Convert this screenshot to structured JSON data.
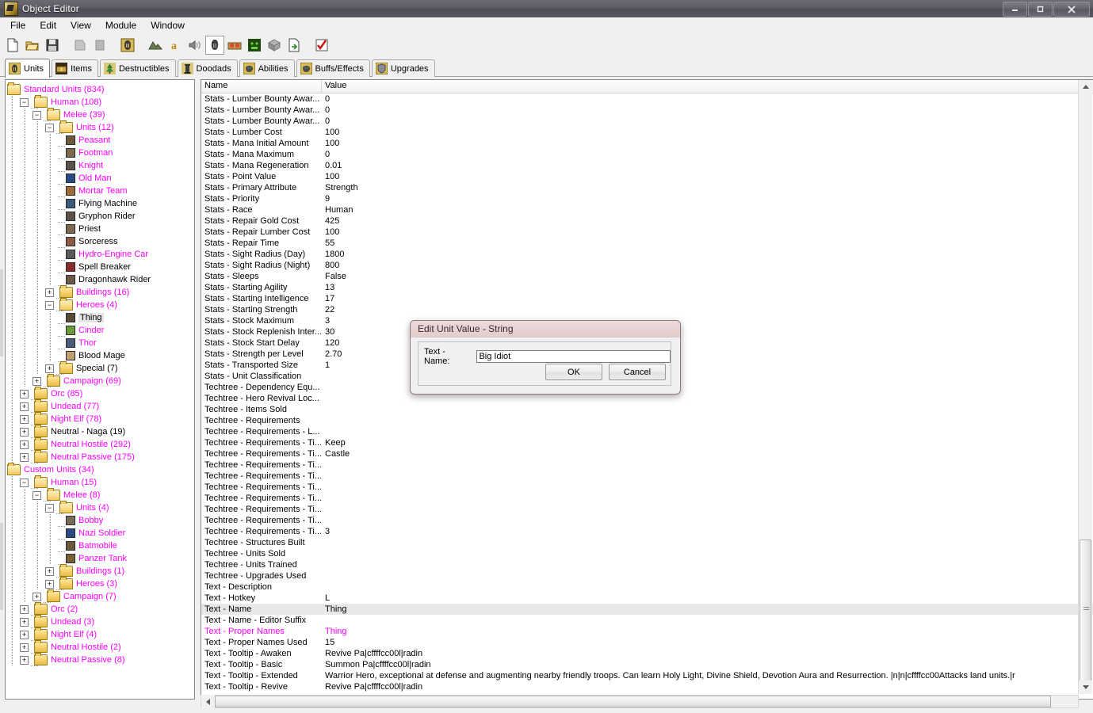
{
  "window": {
    "title": "Object Editor",
    "icon": "warcraft-object-editor-icon",
    "minimize": "–",
    "maximize": "❐",
    "close": "✕"
  },
  "menubar": {
    "items": [
      "File",
      "Edit",
      "View",
      "Module",
      "Window"
    ]
  },
  "toolbar": {
    "buttons": [
      {
        "name": "new-file-button",
        "icon": "new-document-icon",
        "enabled": true,
        "pressed": false
      },
      {
        "name": "open-file-button",
        "icon": "open-folder-icon",
        "enabled": true,
        "pressed": false
      },
      {
        "name": "save-file-button",
        "icon": "floppy-save-icon",
        "enabled": true,
        "pressed": false
      },
      {
        "name": "copy-button",
        "icon": "copy-icon",
        "enabled": false,
        "pressed": false
      },
      {
        "name": "paste-button",
        "icon": "paste-icon",
        "enabled": false,
        "pressed": false
      },
      {
        "name": "object-editor-button",
        "icon": "helmet-icon",
        "enabled": true,
        "pressed": false
      },
      {
        "name": "terrain-editor-button",
        "icon": "terrain-icon",
        "enabled": true,
        "pressed": false
      },
      {
        "name": "trigger-editor-button",
        "icon": "letter-a-icon",
        "enabled": true,
        "pressed": false
      },
      {
        "name": "sound-editor-button",
        "icon": "speaker-icon",
        "enabled": true,
        "pressed": false
      },
      {
        "name": "unit-palette-button",
        "icon": "helmet-dark-icon",
        "enabled": true,
        "pressed": true
      },
      {
        "name": "import-manager-button",
        "icon": "chest-icon",
        "enabled": true,
        "pressed": false
      },
      {
        "name": "ai-editor-button",
        "icon": "orc-face-icon",
        "enabled": true,
        "pressed": false
      },
      {
        "name": "object-manager-button",
        "icon": "cube-icon",
        "enabled": true,
        "pressed": false
      },
      {
        "name": "export-button",
        "icon": "export-page-icon",
        "enabled": true,
        "pressed": false
      },
      {
        "name": "test-map-button",
        "icon": "checkmark-icon",
        "enabled": true,
        "pressed": false
      }
    ]
  },
  "tabs": {
    "items": [
      {
        "label": "Units",
        "icon": "helmet-icon",
        "active": true
      },
      {
        "label": "Items",
        "icon": "chest-icon",
        "active": false
      },
      {
        "label": "Destructibles",
        "icon": "tree-icon",
        "active": false
      },
      {
        "label": "Doodads",
        "icon": "tower-icon",
        "active": false
      },
      {
        "label": "Abilities",
        "icon": "fist-icon",
        "active": false
      },
      {
        "label": "Buffs/Effects",
        "icon": "fist-icon",
        "active": false
      },
      {
        "label": "Upgrades",
        "icon": "shield-icon",
        "active": false
      }
    ]
  },
  "tree": {
    "nodes": [
      {
        "label": "Standard Units (834)",
        "depth": 0,
        "type": "folder-open",
        "expander": "none",
        "modified": true
      },
      {
        "label": "Human (108)",
        "depth": 1,
        "type": "folder-open",
        "expander": "minus",
        "modified": true
      },
      {
        "label": "Melee (39)",
        "depth": 2,
        "type": "folder-open",
        "expander": "minus",
        "modified": true
      },
      {
        "label": "Units (12)",
        "depth": 3,
        "type": "folder-open",
        "expander": "minus",
        "modified": true
      },
      {
        "label": "Peasant",
        "depth": 4,
        "type": "unit",
        "expander": "none",
        "modified": true,
        "color": "#6b5a3e"
      },
      {
        "label": "Footman",
        "depth": 4,
        "type": "unit",
        "expander": "none",
        "modified": true,
        "color": "#7a6a4a"
      },
      {
        "label": "Knight",
        "depth": 4,
        "type": "unit",
        "expander": "none",
        "modified": true,
        "color": "#59514a"
      },
      {
        "label": "Old Man",
        "depth": 4,
        "type": "unit",
        "expander": "none",
        "modified": true,
        "color": "#2a4a86"
      },
      {
        "label": "Mortar Team",
        "depth": 4,
        "type": "unit",
        "expander": "none",
        "modified": true,
        "color": "#a06a38"
      },
      {
        "label": "Flying Machine",
        "depth": 4,
        "type": "unit",
        "expander": "none",
        "modified": false,
        "color": "#3a5a7a"
      },
      {
        "label": "Gryphon Rider",
        "depth": 4,
        "type": "unit",
        "expander": "none",
        "modified": false,
        "color": "#5a5248"
      },
      {
        "label": "Priest",
        "depth": 4,
        "type": "unit",
        "expander": "none",
        "modified": false,
        "color": "#7a6850"
      },
      {
        "label": "Sorceress",
        "depth": 4,
        "type": "unit",
        "expander": "none",
        "modified": false,
        "color": "#8a5a42"
      },
      {
        "label": "Hydro-Engine Car",
        "depth": 4,
        "type": "unit",
        "expander": "none",
        "modified": true,
        "color": "#5a5a5a"
      },
      {
        "label": "Spell Breaker",
        "depth": 4,
        "type": "unit",
        "expander": "none",
        "modified": false,
        "color": "#8a2a2a"
      },
      {
        "label": "Dragonhawk Rider",
        "depth": 4,
        "type": "unit",
        "expander": "none",
        "modified": false,
        "color": "#6a5a4a"
      },
      {
        "label": "Buildings (16)",
        "depth": 3,
        "type": "folder",
        "expander": "plus",
        "modified": true
      },
      {
        "label": "Heroes (4)",
        "depth": 3,
        "type": "folder-open",
        "expander": "minus",
        "modified": true
      },
      {
        "label": "Thing",
        "depth": 4,
        "type": "unit",
        "expander": "none",
        "modified": false,
        "selected": true,
        "color": "#5a4a3a"
      },
      {
        "label": "Cinder",
        "depth": 4,
        "type": "unit",
        "expander": "none",
        "modified": true,
        "color": "#6a9a3a"
      },
      {
        "label": "Thor",
        "depth": 4,
        "type": "unit",
        "expander": "none",
        "modified": true,
        "color": "#4a5a7a"
      },
      {
        "label": "Blood Mage",
        "depth": 4,
        "type": "unit",
        "expander": "none",
        "modified": false,
        "color": "#c0a070"
      },
      {
        "label": "Special (7)",
        "depth": 3,
        "type": "folder",
        "expander": "plus",
        "modified": false
      },
      {
        "label": "Campaign (69)",
        "depth": 2,
        "type": "folder",
        "expander": "plus",
        "modified": true
      },
      {
        "label": "Orc (85)",
        "depth": 1,
        "type": "folder",
        "expander": "plus",
        "modified": true
      },
      {
        "label": "Undead (77)",
        "depth": 1,
        "type": "folder",
        "expander": "plus",
        "modified": true
      },
      {
        "label": "Night Elf (78)",
        "depth": 1,
        "type": "folder",
        "expander": "plus",
        "modified": true
      },
      {
        "label": "Neutral - Naga (19)",
        "depth": 1,
        "type": "folder",
        "expander": "plus",
        "modified": false
      },
      {
        "label": "Neutral Hostile (292)",
        "depth": 1,
        "type": "folder",
        "expander": "plus",
        "modified": true
      },
      {
        "label": "Neutral Passive (175)",
        "depth": 1,
        "type": "folder",
        "expander": "plus",
        "modified": true
      },
      {
        "label": "Custom Units (34)",
        "depth": 0,
        "type": "folder-open",
        "expander": "none",
        "modified": true
      },
      {
        "label": "Human (15)",
        "depth": 1,
        "type": "folder-open",
        "expander": "minus",
        "modified": true
      },
      {
        "label": "Melee (8)",
        "depth": 2,
        "type": "folder-open",
        "expander": "minus",
        "modified": true
      },
      {
        "label": "Units (4)",
        "depth": 3,
        "type": "folder-open",
        "expander": "minus",
        "modified": true
      },
      {
        "label": "Bobby",
        "depth": 4,
        "type": "unit",
        "expander": "none",
        "modified": true,
        "color": "#7a6a5a"
      },
      {
        "label": "Nazi Soldier",
        "depth": 4,
        "type": "unit",
        "expander": "none",
        "modified": true,
        "color": "#2a4a86"
      },
      {
        "label": "Batmobile",
        "depth": 4,
        "type": "unit",
        "expander": "none",
        "modified": true,
        "color": "#6a5a3a"
      },
      {
        "label": "Panzer Tank",
        "depth": 4,
        "type": "unit",
        "expander": "none",
        "modified": true,
        "color": "#7a6238"
      },
      {
        "label": "Buildings (1)",
        "depth": 3,
        "type": "folder",
        "expander": "plus",
        "modified": true
      },
      {
        "label": "Heroes (3)",
        "depth": 3,
        "type": "folder",
        "expander": "plus",
        "modified": true
      },
      {
        "label": "Campaign (7)",
        "depth": 2,
        "type": "folder",
        "expander": "plus",
        "modified": true
      },
      {
        "label": "Orc (2)",
        "depth": 1,
        "type": "folder",
        "expander": "plus",
        "modified": true
      },
      {
        "label": "Undead (3)",
        "depth": 1,
        "type": "folder",
        "expander": "plus",
        "modified": true
      },
      {
        "label": "Night Elf (4)",
        "depth": 1,
        "type": "folder",
        "expander": "plus",
        "modified": true
      },
      {
        "label": "Neutral Hostile (2)",
        "depth": 1,
        "type": "folder",
        "expander": "plus",
        "modified": true
      },
      {
        "label": "Neutral Passive (8)",
        "depth": 1,
        "type": "folder",
        "expander": "plus",
        "modified": true
      }
    ]
  },
  "proplist": {
    "columns": [
      "Name",
      "Value"
    ],
    "rows": [
      {
        "name": "Stats - Lumber Bounty Awar...",
        "value": "0",
        "modified": false
      },
      {
        "name": "Stats - Lumber Bounty Awar...",
        "value": "0",
        "modified": false
      },
      {
        "name": "Stats - Lumber Bounty Awar...",
        "value": "0",
        "modified": false
      },
      {
        "name": "Stats - Lumber Cost",
        "value": "100",
        "modified": false
      },
      {
        "name": "Stats - Mana Initial Amount",
        "value": "100",
        "modified": false
      },
      {
        "name": "Stats - Mana Maximum",
        "value": "0",
        "modified": false
      },
      {
        "name": "Stats - Mana Regeneration",
        "value": "0.01",
        "modified": false
      },
      {
        "name": "Stats - Point Value",
        "value": "100",
        "modified": false
      },
      {
        "name": "Stats - Primary Attribute",
        "value": "Strength",
        "modified": false
      },
      {
        "name": "Stats - Priority",
        "value": "9",
        "modified": false
      },
      {
        "name": "Stats - Race",
        "value": "Human",
        "modified": false
      },
      {
        "name": "Stats - Repair Gold Cost",
        "value": "425",
        "modified": false
      },
      {
        "name": "Stats - Repair Lumber Cost",
        "value": "100",
        "modified": false
      },
      {
        "name": "Stats - Repair Time",
        "value": "55",
        "modified": false
      },
      {
        "name": "Stats - Sight Radius (Day)",
        "value": "1800",
        "modified": false
      },
      {
        "name": "Stats - Sight Radius (Night)",
        "value": "800",
        "modified": false
      },
      {
        "name": "Stats - Sleeps",
        "value": "False",
        "modified": false
      },
      {
        "name": "Stats - Starting Agility",
        "value": "13",
        "modified": false
      },
      {
        "name": "Stats - Starting Intelligence",
        "value": "17",
        "modified": false
      },
      {
        "name": "Stats - Starting Strength",
        "value": "22",
        "modified": false
      },
      {
        "name": "Stats - Stock Maximum",
        "value": "3",
        "modified": false
      },
      {
        "name": "Stats - Stock Replenish Inter...",
        "value": "30",
        "modified": false
      },
      {
        "name": "Stats - Stock Start Delay",
        "value": "120",
        "modified": false
      },
      {
        "name": "Stats - Strength per Level",
        "value": "2.70",
        "modified": false
      },
      {
        "name": "Stats - Transported Size",
        "value": "1",
        "modified": false
      },
      {
        "name": "Stats - Unit Classification",
        "value": "",
        "modified": false
      },
      {
        "name": "Techtree - Dependency Equ...",
        "value": "",
        "modified": false
      },
      {
        "name": "Techtree - Hero Revival Loc...",
        "value": "",
        "modified": false
      },
      {
        "name": "Techtree - Items Sold",
        "value": "",
        "modified": false
      },
      {
        "name": "Techtree - Requirements",
        "value": "",
        "modified": false
      },
      {
        "name": "Techtree - Requirements - L...",
        "value": "",
        "modified": false
      },
      {
        "name": "Techtree - Requirements - Ti...",
        "value": "Keep",
        "modified": false
      },
      {
        "name": "Techtree - Requirements - Ti...",
        "value": "Castle",
        "modified": false
      },
      {
        "name": "Techtree - Requirements - Ti...",
        "value": "",
        "modified": false
      },
      {
        "name": "Techtree - Requirements - Ti...",
        "value": "",
        "modified": false
      },
      {
        "name": "Techtree - Requirements - Ti...",
        "value": "",
        "modified": false
      },
      {
        "name": "Techtree - Requirements - Ti...",
        "value": "",
        "modified": false
      },
      {
        "name": "Techtree - Requirements - Ti...",
        "value": "",
        "modified": false
      },
      {
        "name": "Techtree - Requirements - Ti...",
        "value": "",
        "modified": false
      },
      {
        "name": "Techtree - Requirements - Ti...",
        "value": "3",
        "modified": false
      },
      {
        "name": "Techtree - Structures Built",
        "value": "",
        "modified": false
      },
      {
        "name": "Techtree - Units Sold",
        "value": "",
        "modified": false
      },
      {
        "name": "Techtree - Units Trained",
        "value": "",
        "modified": false
      },
      {
        "name": "Techtree - Upgrades Used",
        "value": "",
        "modified": false
      },
      {
        "name": "Text - Description",
        "value": "",
        "modified": false
      },
      {
        "name": "Text - Hotkey",
        "value": "L",
        "modified": false
      },
      {
        "name": "Text - Name",
        "value": "Thing",
        "modified": false,
        "selected": true
      },
      {
        "name": "Text - Name - Editor Suffix",
        "value": "",
        "modified": false
      },
      {
        "name": "Text - Proper Names",
        "value": "Thing",
        "modified": true
      },
      {
        "name": "Text - Proper Names Used",
        "value": "15",
        "modified": false
      },
      {
        "name": "Text - Tooltip - Awaken",
        "value": "Revive Pa|cffffcc00l|radin",
        "modified": false
      },
      {
        "name": "Text - Tooltip - Basic",
        "value": "Summon Pa|cffffcc00l|radin",
        "modified": false
      },
      {
        "name": "Text - Tooltip - Extended",
        "value": "Warrior Hero, exceptional at defense and augmenting nearby friendly troops. Can learn Holy Light, Divine Shield, Devotion Aura and Resurrection. |n|n|cffffcc00Attacks land units.|r",
        "modified": false
      },
      {
        "name": "Text - Tooltip - Revive",
        "value": "Revive Pa|cffffcc00l|radin",
        "modified": false
      }
    ]
  },
  "dialog": {
    "title": "Edit Unit Value - String",
    "field_label": "Text - Name:",
    "field_value": "Big Idiot",
    "ok_label": "OK",
    "cancel_label": "Cancel"
  },
  "colors": {
    "modified_text": "#ff00ff",
    "selection": "#e8e8e8",
    "dialog_titlebar": "#e9d5d5",
    "window_titlebar": "#56565f"
  }
}
